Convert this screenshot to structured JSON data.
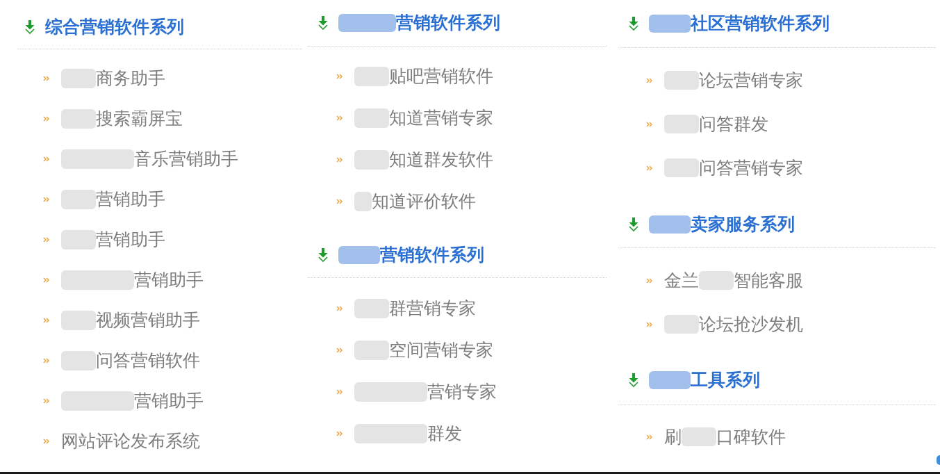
{
  "columns": [
    {
      "sections": [
        {
          "kind": "plain",
          "title": "综合营销软件系列",
          "items": [
            {
              "kind": "blurred",
              "text": "商务助手"
            },
            {
              "kind": "blurred",
              "text": "搜索霸屏宝"
            },
            {
              "kind": "wideblur",
              "text": "音乐营销助手"
            },
            {
              "kind": "blurred",
              "text": "营销助手"
            },
            {
              "kind": "blurred",
              "text": "营销助手"
            },
            {
              "kind": "wideblur",
              "text": "营销助手"
            },
            {
              "kind": "blurred",
              "text": "视频营销助手"
            },
            {
              "kind": "blurred",
              "text": "问答营销软件"
            },
            {
              "kind": "wideblur",
              "text": "营销助手"
            },
            {
              "kind": "plain",
              "text": "网站评论发布系统"
            }
          ]
        }
      ]
    },
    {
      "sections": [
        {
          "kind": "wideblur",
          "title": "营销软件系列",
          "items": [
            {
              "kind": "blurred",
              "text": "贴吧营销软件"
            },
            {
              "kind": "blurred",
              "text": "知道营销专家"
            },
            {
              "kind": "blurred",
              "text": "知道群发软件"
            },
            {
              "kind": "narrowblur",
              "text": "知道评价软件"
            }
          ]
        },
        {
          "kind": "blurred",
          "title": "营销软件系列",
          "items": [
            {
              "kind": "blurred",
              "text": "群营销专家"
            },
            {
              "kind": "blurred",
              "text": "空间营销专家"
            },
            {
              "kind": "wideblur",
              "text": "营销专家"
            },
            {
              "kind": "wideblur",
              "text": "群发"
            }
          ]
        }
      ]
    },
    {
      "sections": [
        {
          "kind": "blurred",
          "title": "社区营销软件系列",
          "items": [
            {
              "kind": "blurred",
              "text": "论坛营销专家"
            },
            {
              "kind": "blurred",
              "text": "问答群发"
            },
            {
              "kind": "blurred",
              "text": "问答营销专家"
            }
          ]
        },
        {
          "kind": "blurred",
          "title": "卖家服务系列",
          "items": [
            {
              "kind": "blurred",
              "prefix": "金兰",
              "text": "智能客服"
            },
            {
              "kind": "blurred",
              "text": "论坛抢沙发机"
            }
          ]
        },
        {
          "kind": "blurred",
          "title": "工具系列",
          "items": [
            {
              "kind": "blurred",
              "prefix": "刷",
              "text": "口碑软件"
            }
          ]
        }
      ]
    }
  ]
}
